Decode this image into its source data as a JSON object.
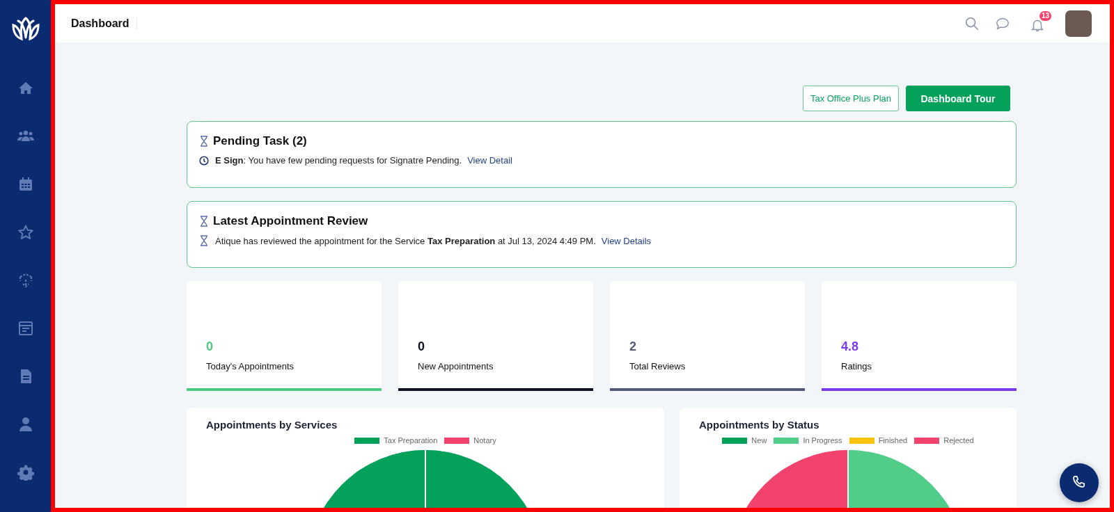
{
  "header": {
    "title": "Dashboard",
    "notification_count": "13"
  },
  "actions": [
    {
      "label": "Tax Office Plus Plan",
      "kind": "outline"
    },
    {
      "label": "Dashboard Tour",
      "kind": "primary"
    }
  ],
  "pending_task": {
    "title": "Pending Task (2)",
    "items": [
      {
        "text": "**E Sign**: You have few pending requests for Signatre Pending.",
        "link": "View Detail"
      }
    ]
  },
  "latest_review": {
    "title": "Latest Appointment Review",
    "items": [
      {
        "text": "Atique has reviewed the appointment for the Service **Tax Preparation** at Jul 13, 2024 4:49 PM.",
        "link": "View Details"
      }
    ]
  },
  "stats": [
    {
      "value": "0",
      "label": "Today's Appointments",
      "color": "#4cc97f"
    },
    {
      "value": "0",
      "label": "New Appointments",
      "color": "#0f1222"
    },
    {
      "value": "2",
      "label": "Total Reviews",
      "color": "#525a78"
    },
    {
      "value": "4.8",
      "label": "Ratings",
      "color": "#7c3aed"
    }
  ],
  "charts": [
    {
      "title": "Appointments by Services",
      "legend": [
        {
          "label": "Tax Preparation",
          "color": "#03a15a"
        },
        {
          "label": "Notary",
          "color": "#f2436f"
        }
      ]
    },
    {
      "title": "Appointments by Status",
      "legend": [
        {
          "label": "New",
          "color": "#03a15a"
        },
        {
          "label": "In Progress",
          "color": "#4fcd89"
        },
        {
          "label": "Finished",
          "color": "#fbc30b"
        },
        {
          "label": "Rejected",
          "color": "#f2436f"
        }
      ]
    }
  ]
}
